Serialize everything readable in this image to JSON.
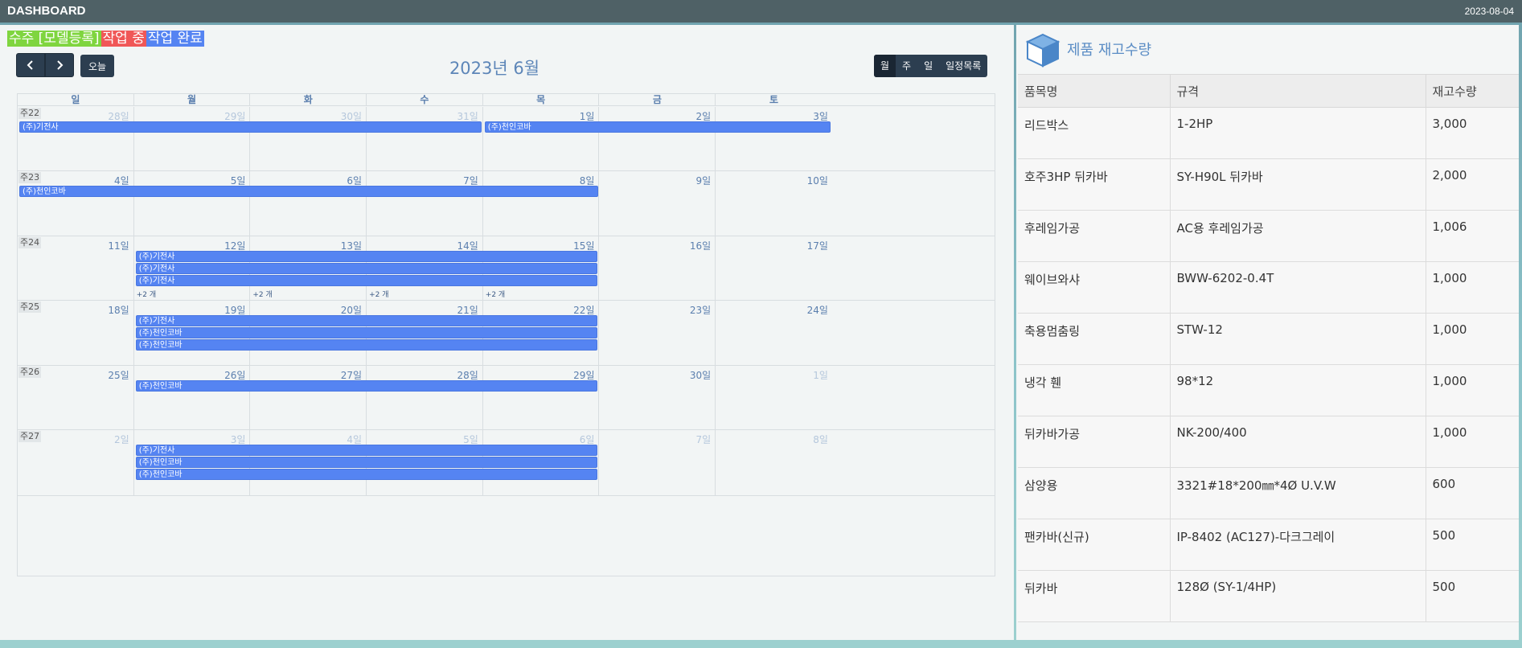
{
  "header": {
    "title": "DASHBOARD",
    "date": "2023-08-04"
  },
  "legend": [
    {
      "label": "수주 [모델등록]",
      "color": "#7fd53f"
    },
    {
      "label": "작업 중",
      "color": "#f05757"
    },
    {
      "label": "작업 완료",
      "color": "#5584f2"
    }
  ],
  "calendar": {
    "today_label": "오늘",
    "title": "2023년 6월",
    "views": [
      "월",
      "주",
      "일",
      "일정목록"
    ],
    "weekdays": [
      "일",
      "월",
      "화",
      "수",
      "목",
      "금",
      "토"
    ],
    "more_label": "+2 개",
    "weeks": [
      {
        "label": "주22",
        "days": [
          "28일",
          "29일",
          "30일",
          "31일",
          "1일",
          "2일",
          "3일"
        ]
      },
      {
        "label": "주23",
        "days": [
          "4일",
          "5일",
          "6일",
          "7일",
          "8일",
          "9일",
          "10일"
        ]
      },
      {
        "label": "주24",
        "days": [
          "11일",
          "12일",
          "13일",
          "14일",
          "15일",
          "16일",
          "17일"
        ]
      },
      {
        "label": "주25",
        "days": [
          "18일",
          "19일",
          "20일",
          "21일",
          "22일",
          "23일",
          "24일"
        ]
      },
      {
        "label": "주26",
        "days": [
          "25일",
          "26일",
          "27일",
          "28일",
          "29일",
          "30일",
          "1일"
        ]
      },
      {
        "label": "주27",
        "days": [
          "2일",
          "3일",
          "4일",
          "5일",
          "6일",
          "7일",
          "8일"
        ]
      }
    ],
    "events": {
      "e1": "(주)기전사",
      "e2": "(주)천인코바",
      "e3": "(주)천인코바",
      "e4": "(주)기전사",
      "e5": "(주)기전사",
      "e6": "(주)기전사",
      "e7": "(주)기전사",
      "e8": "(주)천인코바",
      "e9": "(주)천인코바",
      "e10": "(주)천인코바",
      "e11": "(주)기전사",
      "e12": "(주)천인코바",
      "e13": "(주)천인코바"
    }
  },
  "stock": {
    "title": "제품 재고수량",
    "columns": [
      "품목명",
      "규격",
      "재고수량"
    ],
    "rows": [
      [
        "리드박스",
        "1-2HP",
        "3,000"
      ],
      [
        "호주3HP 뒤카바",
        "SY-H90L 뒤카바",
        "2,000"
      ],
      [
        "후레임가공",
        "AC용 후레임가공",
        "1,006"
      ],
      [
        "웨이브와샤",
        "BWW-6202-0.4T",
        "1,000"
      ],
      [
        "축용멈춤링",
        "STW-12",
        "1,000"
      ],
      [
        "냉각 휀",
        "98*12",
        "1,000"
      ],
      [
        "뒤카바가공",
        "NK-200/400",
        "1,000"
      ],
      [
        "삼양용",
        "3321#18*200㎜*4Ø U.V.W",
        "600"
      ],
      [
        "팬카바(신규)",
        "IP-8402 (AC127)-다크그레이",
        "500"
      ],
      [
        "뒤카바",
        "128Ø (SY-1/4HP)",
        "500"
      ]
    ]
  }
}
